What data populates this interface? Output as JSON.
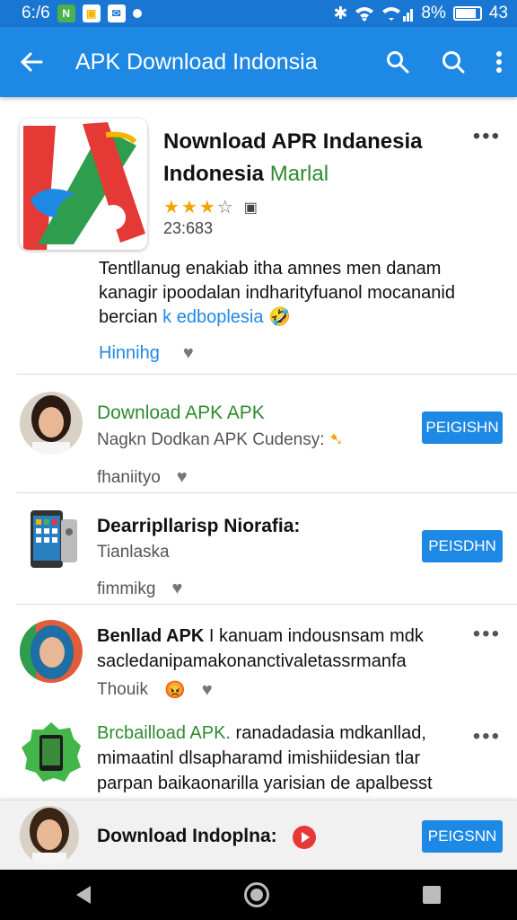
{
  "status_bar": {
    "time": "6:/6",
    "battery": "8%",
    "clock_right": "43"
  },
  "app_bar": {
    "title": "APK Download Indonsia"
  },
  "hero": {
    "title_line1": "Nownload APR Indanesia",
    "title_line2_main": "Indonesia",
    "title_line2_sub": "Marlal",
    "rating_count": "23:683",
    "stars_filled": 3,
    "stars_total": 4,
    "description": "Tentllanug enakiab itha amnes men danam kanagir ipoodalan indharityfuanol mocananid bercian",
    "description_link": "k edboplesia",
    "link_label": "Hinnihg"
  },
  "rows": [
    {
      "title": "Download APK APK",
      "subtitle": "Nagkn Dodkan APK Cudensy:",
      "footer": "fhaniityo",
      "button": "PEIGISHN"
    },
    {
      "title": "Dearripllarisp Niorafia:",
      "subtitle": "Tianlaska",
      "footer": "fimmikg",
      "button": "PEISDHN"
    },
    {
      "title_bold": "Benllad APK",
      "text": "I kanuam indousnsam mdk saclеdanipamakonanctivaletassrmanfa",
      "footer": "Thouik"
    },
    {
      "title_green": "Brcbailload APK.",
      "text": "ranadadasia mdkanllad, mimaatinl dlsapharamd imishiidesian tlar parpan baikaonarilla yarisian de apalbesst"
    }
  ],
  "sticky": {
    "title": "Download Indoplna:",
    "button": "PEIGSNN"
  }
}
